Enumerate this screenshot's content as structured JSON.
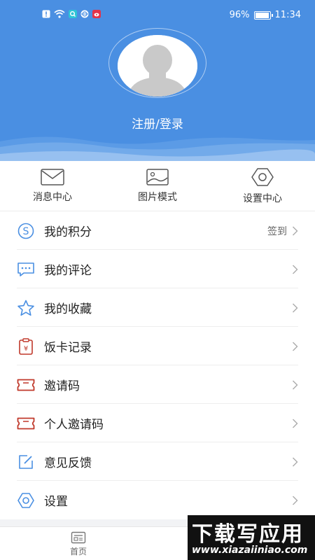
{
  "status_bar": {
    "battery": "96%",
    "battery_level": 0.96,
    "time": "11:34",
    "icons": [
      "alert-icon",
      "wifi-icon",
      "search-app-icon",
      "browser-icon",
      "weibo-icon"
    ]
  },
  "header": {
    "login_text": "注册/登录",
    "accent": "#4a8fe2"
  },
  "quick_actions": [
    {
      "label": "消息中心",
      "icon": "mail-icon"
    },
    {
      "label": "图片模式",
      "icon": "image-icon"
    },
    {
      "label": "设置中心",
      "icon": "gear-icon"
    }
  ],
  "menu": [
    {
      "label": "我的积分",
      "icon": "points-icon",
      "extra": "签到",
      "icon_color": "#4a8fe2"
    },
    {
      "label": "我的评论",
      "icon": "comment-icon",
      "extra": "",
      "icon_color": "#4a8fe2"
    },
    {
      "label": "我的收藏",
      "icon": "star-icon",
      "extra": "",
      "icon_color": "#4a8fe2"
    },
    {
      "label": "饭卡记录",
      "icon": "meal-card-icon",
      "extra": "",
      "icon_color": "#c0392b"
    },
    {
      "label": "邀请码",
      "icon": "ticket-icon",
      "extra": "",
      "icon_color": "#c0392b"
    },
    {
      "label": "个人邀请码",
      "icon": "ticket-icon",
      "extra": "",
      "icon_color": "#c0392b"
    },
    {
      "label": "意见反馈",
      "icon": "edit-icon",
      "extra": "",
      "icon_color": "#4a8fe2"
    },
    {
      "label": "设置",
      "icon": "settings-icon",
      "extra": "",
      "icon_color": "#4a8fe2"
    }
  ],
  "bottom_nav": {
    "home_label": "首页"
  },
  "watermark": {
    "big": "下载写应用",
    "small": "www.xiazaiiniao.com"
  }
}
